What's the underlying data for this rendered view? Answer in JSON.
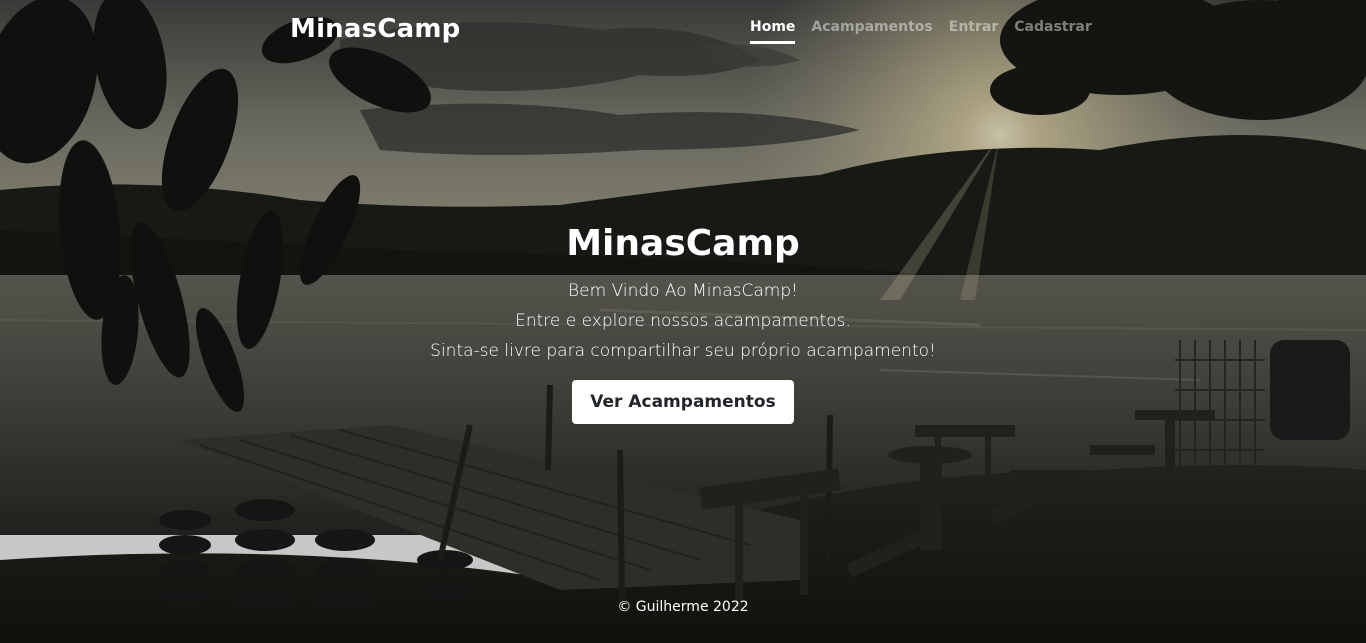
{
  "brand": "MinasCamp",
  "nav": {
    "home": "Home",
    "camps": "Acampamentos",
    "login": "Entrar",
    "register": "Cadastrar"
  },
  "hero": {
    "title": "MinasCamp",
    "lines": [
      "Bem Vindo Ao MinasCamp!",
      "Entre e explore nossos acampamentos.",
      "Sinta-se livre para compartilhar seu próprio acampamento!"
    ],
    "cta": "Ver Acampamentos"
  },
  "footer": "© Guilherme 2022",
  "colors": {
    "text": "#ffffff",
    "button_bg": "#ffffff",
    "button_text": "#212529",
    "muted_nav": "#8a8a8a"
  }
}
